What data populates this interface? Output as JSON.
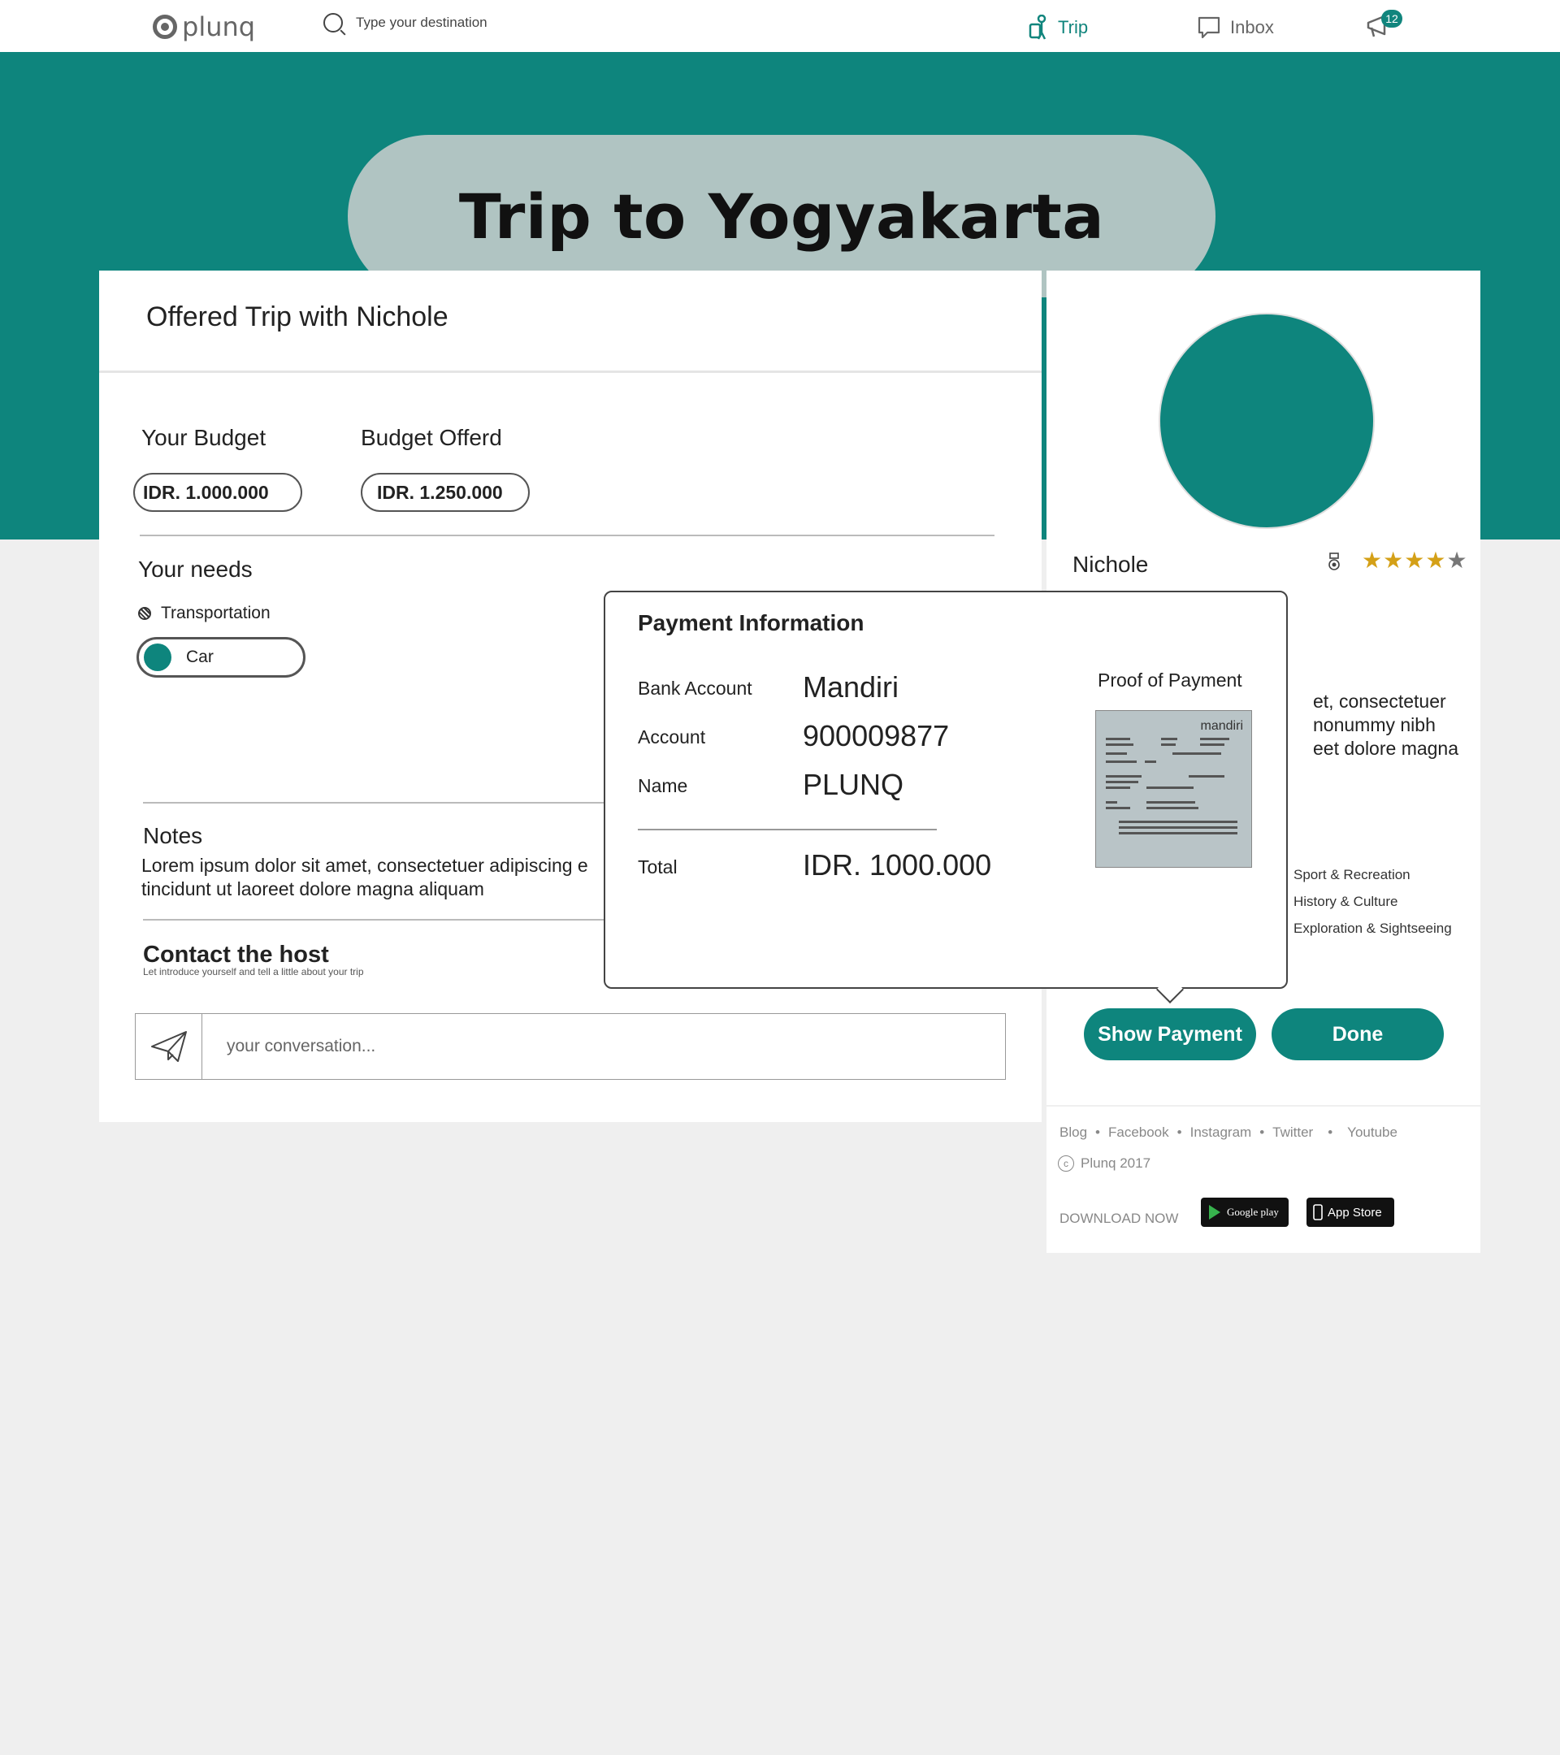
{
  "nav": {
    "logo": "plunq",
    "search_placeholder": "Type your destination",
    "trip": "Trip",
    "inbox": "Inbox",
    "notif_count": "12"
  },
  "banner": {
    "title": "Trip to Yogyakarta"
  },
  "main": {
    "heading": "Offered Trip with Nichole",
    "your_budget_label": "Your Budget",
    "your_budget_value": "IDR. 1.000.000",
    "budget_offered_label": "Budget Offerd",
    "budget_offered_value": "IDR. 1.250.000",
    "needs_title": "Your needs",
    "needs_category": "Transportation",
    "needs_option": "Car",
    "notes_title": "Notes",
    "notes_text_1": "Lorem ipsum dolor sit amet, consectetuer adipiscing e",
    "notes_text_2": "tincidunt ut laoreet dolore magna aliquam",
    "contact_title": "Contact the host",
    "contact_sub": "Let introduce yourself and tell a little about your trip",
    "message_placeholder": "your conversation..."
  },
  "host": {
    "name": "Nichole",
    "rating": 4,
    "rating_max": 5,
    "desc_1": "et, consectetuer",
    "desc_2": "nonummy nibh",
    "desc_3": "eet dolore magna",
    "interests": [
      "Sport & Recreation",
      "History & Culture",
      "Exploration & Sightseeing"
    ],
    "show_payment": "Show Payment",
    "done": "Done"
  },
  "footer": {
    "links": [
      "Blog",
      "Facebook",
      "Instagram",
      "Twitter",
      "Youtube"
    ],
    "copyright": "Plunq 2017",
    "download": "DOWNLOAD NOW",
    "google_play": "Google play",
    "app_store": "App Store"
  },
  "payment": {
    "title": "Payment Information",
    "bank_label": "Bank Account",
    "bank_value": "Mandiri",
    "account_label": "Account",
    "account_value": "900009877",
    "name_label": "Name",
    "name_value": "PLUNQ",
    "total_label": "Total",
    "total_value": "IDR. 1000.000",
    "proof_label": "Proof of Payment",
    "receipt_logo": "mandiri"
  },
  "colors": {
    "accent": "#0e857d",
    "pill": "#b0c4c2",
    "background": "#efefef",
    "star": "#d4a017"
  }
}
